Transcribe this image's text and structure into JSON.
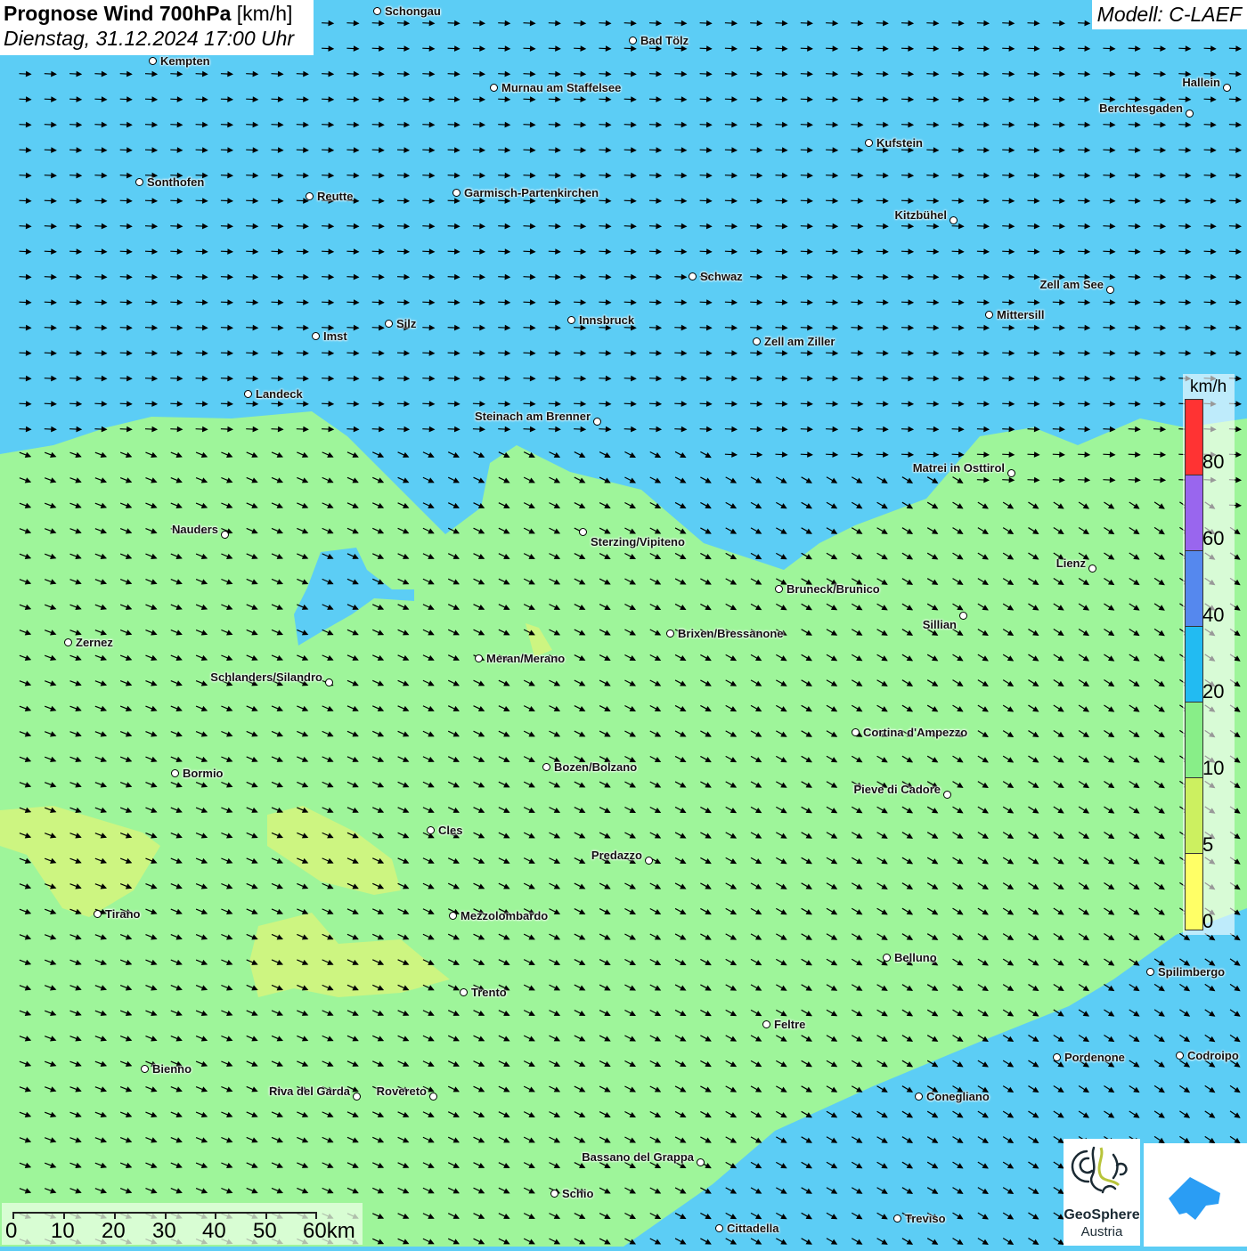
{
  "header": {
    "title_bold": "Prognose Wind 700hPa",
    "title_unit": "[km/h]",
    "subtitle": "Dienstag, 31.12.2024 17:00 Uhr",
    "model": "Modell: C-LAEF"
  },
  "legend": {
    "unit": "km/h",
    "labels": [
      "80",
      "60",
      "40",
      "20",
      "10",
      "5",
      "0"
    ],
    "colors": [
      "#ff3333",
      "#9966ee",
      "#5588ee",
      "#22bbf2",
      "#88ee88",
      "#ccf060",
      "#ffff66"
    ]
  },
  "scale": {
    "labels": [
      "0",
      "10",
      "20",
      "30",
      "40",
      "50",
      "60km"
    ]
  },
  "logos": {
    "geosphere_line1": "GeoSphere",
    "geosphere_line2": "Austria"
  },
  "cities": [
    "Schongau",
    "Bad Tölz",
    "Kempten",
    "Murnau am Staffelsee",
    "Hallein",
    "Berchtesgaden",
    "Kufstein",
    "Sonthofen",
    "Reutte",
    "Garmisch-Partenkirchen",
    "Kitzbühel",
    "Schwaz",
    "Zell am See",
    "Mittersill",
    "Innsbruck",
    "Silz",
    "Imst",
    "Zell am Ziller",
    "Landeck",
    "Steinach am Brenner",
    "Matrei in Osttirol",
    "Nauders",
    "Sterzing/Vipiteno",
    "Lienz",
    "Bruneck/Brunico",
    "Sillian",
    "Brixen/Bressanone",
    "Zernez",
    "Meran/Merano",
    "Schlanders/Silandro",
    "Cortina d'Ampezzo",
    "Bozen/Bolzano",
    "Bormio",
    "Pieve di Cadore",
    "Cles",
    "Predazzo",
    "Tirano",
    "Mezzolombardo",
    "Belluno",
    "Spilimbergo",
    "Trento",
    "Feltre",
    "Pordenone",
    "Codroipo",
    "Bienno",
    "Riva del Garda",
    "Rovereto",
    "Conegliano",
    "Bassano del Grappa",
    "Schio",
    "Treviso",
    "Cittadella"
  ],
  "colors": {
    "wind_10_20": "#9ef59a",
    "wind_20_40": "#5ccdf5",
    "wind_5_10": "#d8f57a"
  }
}
